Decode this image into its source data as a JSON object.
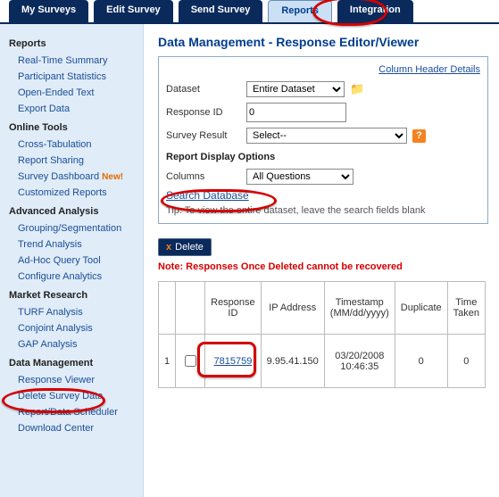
{
  "tabs": {
    "my_surveys": "My Surveys",
    "edit_survey": "Edit Survey",
    "send_survey": "Send Survey",
    "reports": "Reports",
    "integration": "Integration"
  },
  "sidebar": {
    "g1_label": "Reports",
    "g1": {
      "real_time": "Real-Time Summary",
      "participant": "Participant Statistics",
      "open_ended": "Open-Ended Text",
      "export": "Export Data"
    },
    "g2_label": "Online Tools",
    "g2": {
      "cross_tab": "Cross-Tabulation",
      "report_sharing": "Report Sharing",
      "survey_dash": "Survey Dashboard",
      "custom_reports": "Customized Reports"
    },
    "new_badge": "New!",
    "g3_label": "Advanced Analysis",
    "g3": {
      "grouping": "Grouping/Segmentation",
      "trend": "Trend Analysis",
      "adhoc": "Ad-Hoc Query Tool",
      "configure": "Configure Analytics"
    },
    "g4_label": "Market Research",
    "g4": {
      "turf": "TURF Analysis",
      "conjoint": "Conjoint Analysis",
      "gap": "GAP Analysis"
    },
    "g5_label": "Data Management",
    "g5": {
      "resp_viewer": "Response Viewer",
      "delete_survey": "Delete Survey Data",
      "report_sched": "Report/Data Scheduler",
      "download": "Download Center"
    }
  },
  "page": {
    "title": "Data Management - Response Editor/Viewer",
    "col_header_link": "Column Header Details",
    "lbl_dataset": "Dataset",
    "dataset_value": "Entire Dataset",
    "lbl_respid": "Response ID",
    "respid_value": "0",
    "lbl_result": "Survey Result",
    "result_value": "Select--",
    "display_options": "Report Display Options",
    "lbl_columns": "Columns",
    "columns_value": "All Questions",
    "search_btn": "Search Database",
    "tip": "Tip: To view the entire dataset, leave the search fields blank",
    "delete_btn": "Delete",
    "note": "Note: Responses Once Deleted cannot be recovered"
  },
  "table": {
    "hdr_respid": "Response ID",
    "hdr_ip": "IP Address",
    "hdr_ts": "Timestamp (MM/dd/yyyy)",
    "hdr_dup": "Duplicate",
    "hdr_time": "Time Taken",
    "row1": {
      "n": "1",
      "id": "7815759",
      "ip": "9.95.41.150",
      "ts_date": "03/20/2008",
      "ts_time": "10:46:35",
      "dup": "0",
      "taken": "0"
    }
  }
}
